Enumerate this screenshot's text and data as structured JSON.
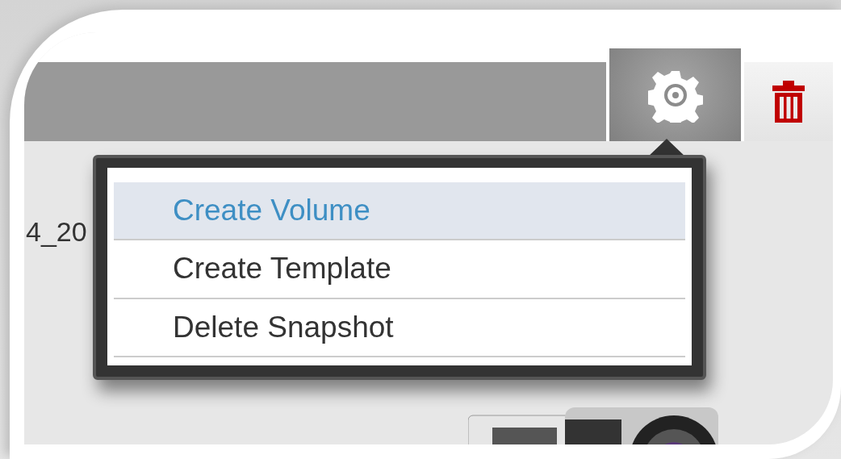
{
  "row_text": "4_20",
  "menu": {
    "items": [
      {
        "label": "Create Volume",
        "selected": true
      },
      {
        "label": "Create Template",
        "selected": false
      },
      {
        "label": "Delete Snapshot",
        "selected": false
      }
    ]
  }
}
